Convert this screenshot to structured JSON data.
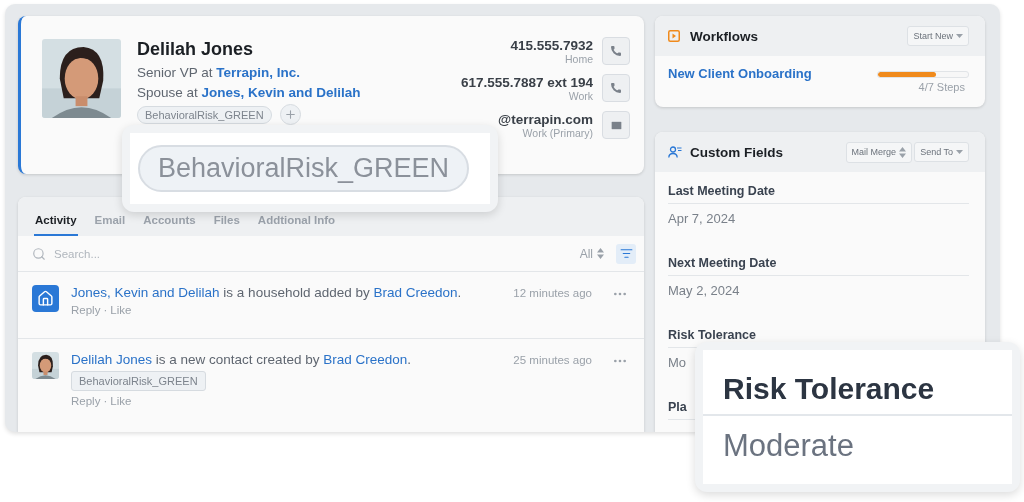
{
  "contact": {
    "name": "Delilah Jones",
    "photo": {
      "kind": "picture"
    },
    "lines": [
      {
        "prefix": "Senior VP at",
        "link": "Terrapin, Inc."
      },
      {
        "prefix": "Spouse at",
        "link": "Jones, Kevin and Delilah"
      }
    ],
    "tags": [
      "BehavioralRisk_GREEN"
    ],
    "methods": [
      {
        "kind": "phone",
        "value": "415.555.7932",
        "label": "Home"
      },
      {
        "kind": "phone",
        "value": "617.555.7887 ext 194",
        "label": "Work"
      },
      {
        "kind": "email",
        "value": "@terrapin.com",
        "label": "Work (Primary)"
      }
    ]
  },
  "activity": {
    "tabs": [
      {
        "label": "Activity",
        "selected": true
      },
      {
        "label": "Email",
        "selected": false
      },
      {
        "label": "Accounts",
        "selected": false
      },
      {
        "label": "Files",
        "selected": false
      },
      {
        "label": "Addtional Info",
        "selected": false
      }
    ],
    "search": {
      "placeholder": "Search..."
    },
    "filter": {
      "label": "All"
    },
    "items": [
      {
        "kind": "household",
        "subject": "Jones, Kevin and Delilah",
        "text": "is a household added by",
        "actor": "Brad Creedon",
        "end": ".",
        "time": "12 minutes ago",
        "actions": [
          "Reply",
          "Like"
        ],
        "separator": "·"
      },
      {
        "kind": "contact",
        "subject": "Delilah Jones",
        "text": "is a new contact created by",
        "actor": "Brad Creedon",
        "end": ".",
        "time": "25 minutes ago",
        "tags": [
          "BehavioralRisk_GREEN"
        ],
        "actions": [
          "Reply",
          "Like"
        ],
        "separator": "·"
      }
    ]
  },
  "workflows": {
    "title": "Workflows",
    "button": "Start New",
    "items": [
      {
        "name": "New Client Onboarding",
        "level": 0.64,
        "steps": "4/7 Steps"
      }
    ]
  },
  "custom_fields": {
    "title": "Custom Fields",
    "buttons": [
      {
        "kind": "stepper",
        "label": "Mail Merge"
      },
      {
        "kind": "dropdown",
        "label": "Send To"
      }
    ],
    "fields": [
      {
        "label": "Last Meeting Date",
        "value": "Apr 7, 2024"
      },
      {
        "label": "Next Meeting Date",
        "value": "May 2, 2024"
      },
      {
        "label": "Risk Tolerance",
        "value": "Mo"
      },
      {
        "label": "Pla"
      }
    ]
  },
  "tag_callout": {
    "tag": "BehavioralRisk_GREEN"
  },
  "field_callout": {
    "label": "Risk Tolerance",
    "value": "Moderate"
  }
}
